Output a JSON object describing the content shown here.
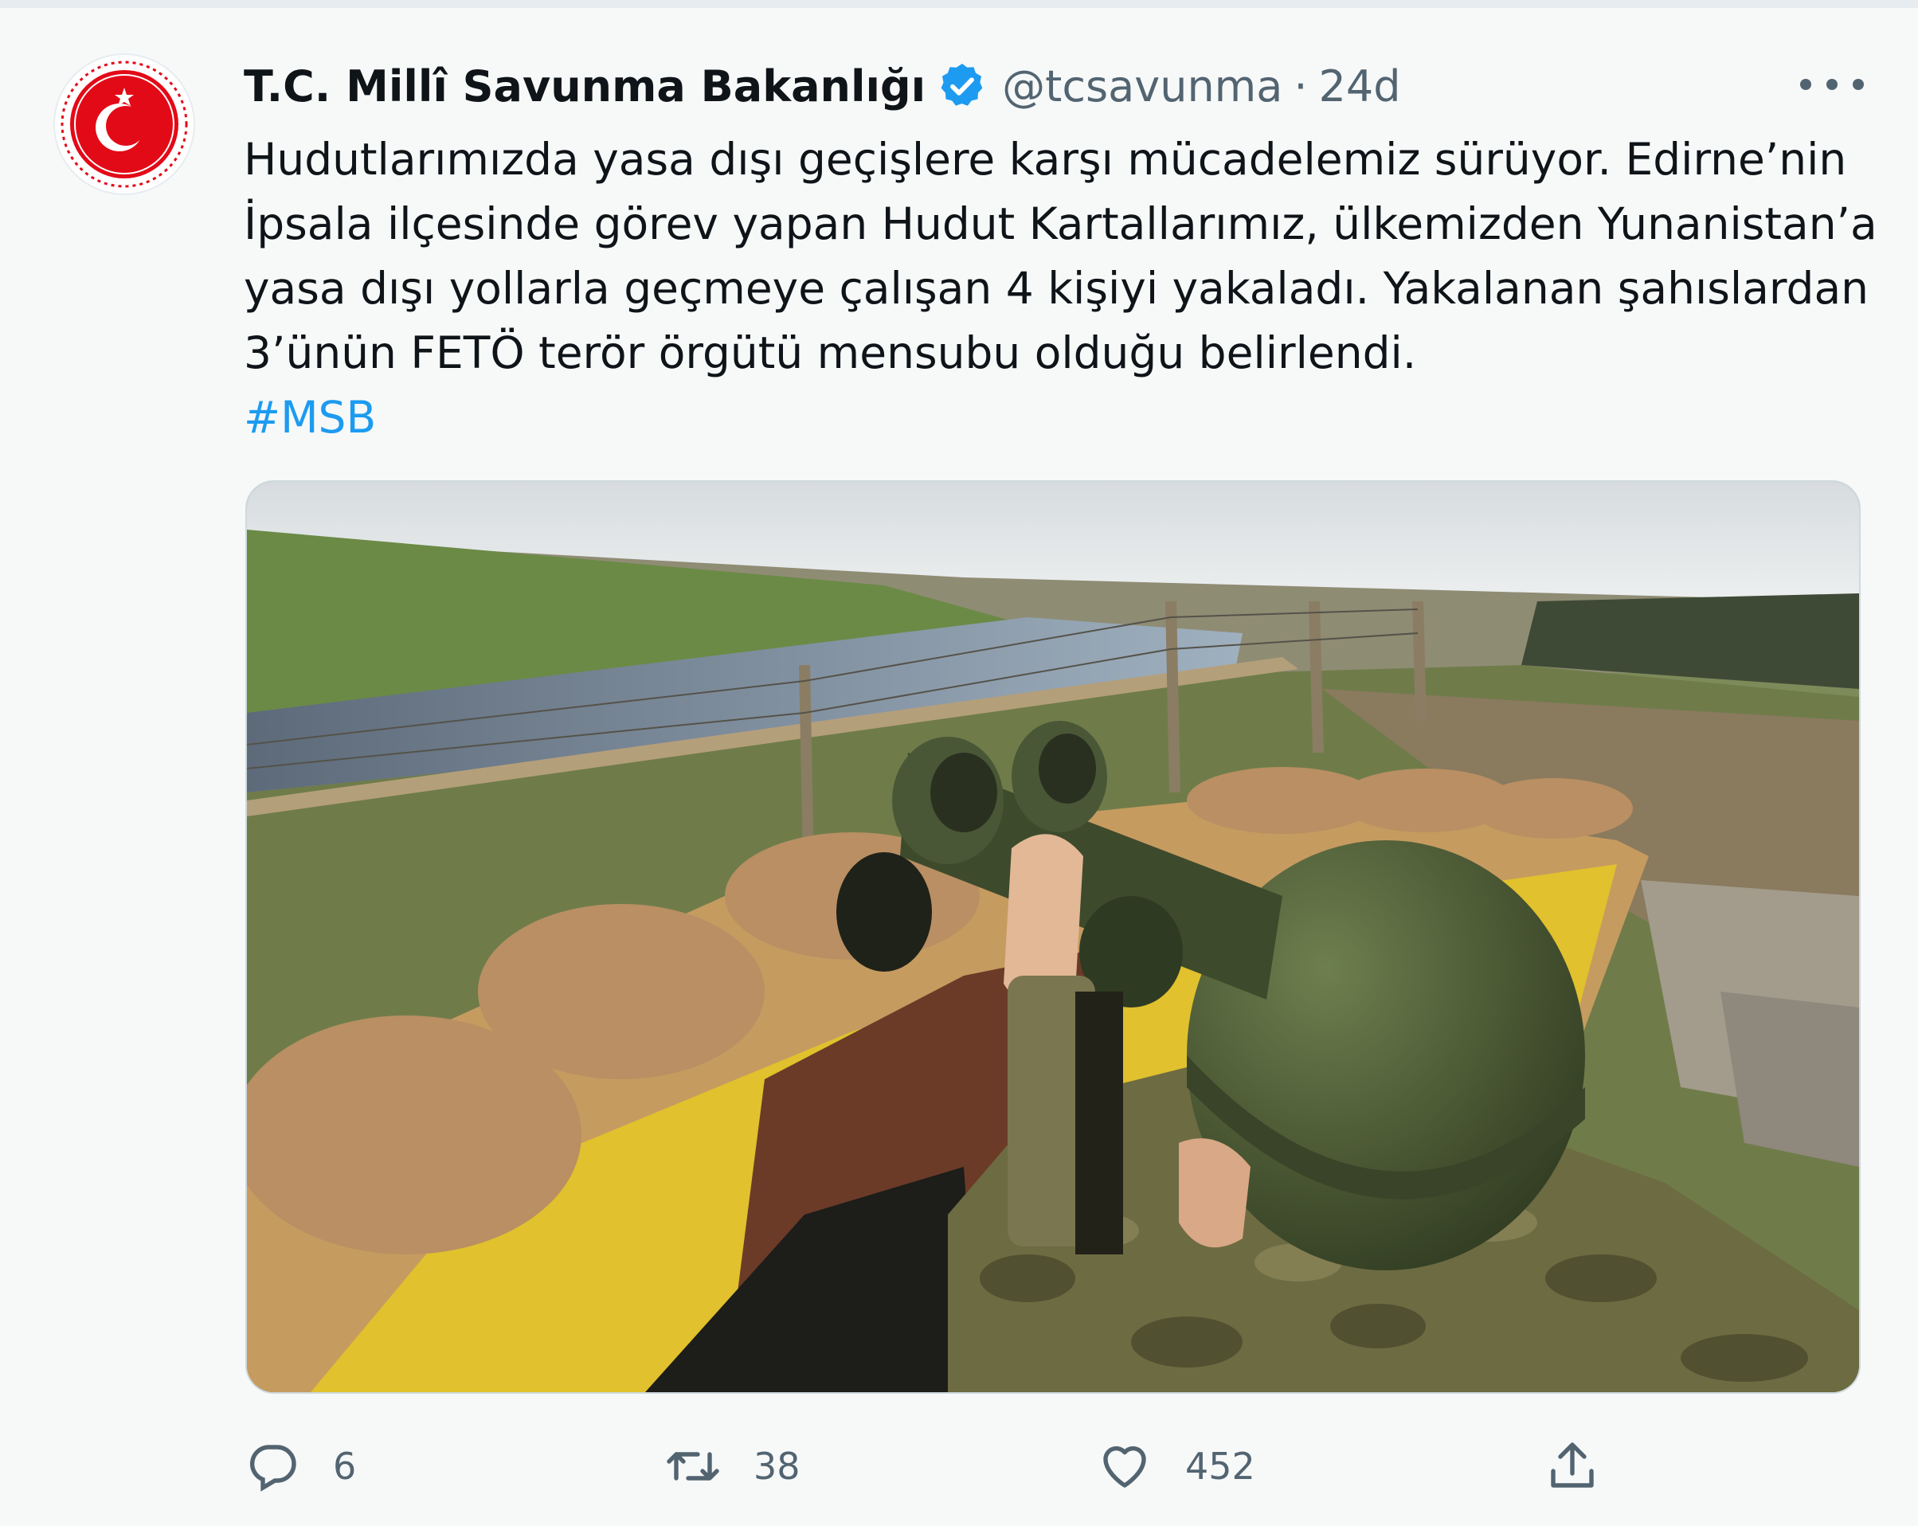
{
  "account": {
    "name": "T.C. Millî Savunma Bakanlığı",
    "handle": "@tcsavunma",
    "separator": "·",
    "time": "24d"
  },
  "tweet": {
    "lines": [
      "Hudutlarımızda yasa dışı geçişlere karşı mücadelemiz sürüyor. Edirne’nin",
      "İpsala ilçesinde görev yapan Hudut Kartallarımız, ülkemizden Yunanistan’a",
      "yasa dışı yollarla geçmeye çalışan 4 kişiyi yakaladı. Yakalanan şahıslardan",
      "3’ünün FETÖ terör örgütü mensubu olduğu belirlendi."
    ],
    "hashtag": "#MSB"
  },
  "actions": {
    "reply_count": "6",
    "retweet_count": "38",
    "like_count": "452"
  },
  "icons": {
    "verified": "verified-badge-icon",
    "more": "more-options-icon",
    "reply": "reply-icon",
    "retweet": "retweet-icon",
    "like": "heart-icon",
    "share": "share-icon"
  },
  "colors": {
    "accent": "#1d9bf0",
    "text": "#0f1419",
    "muted": "#536471",
    "logo_red": "#e30a17"
  }
}
